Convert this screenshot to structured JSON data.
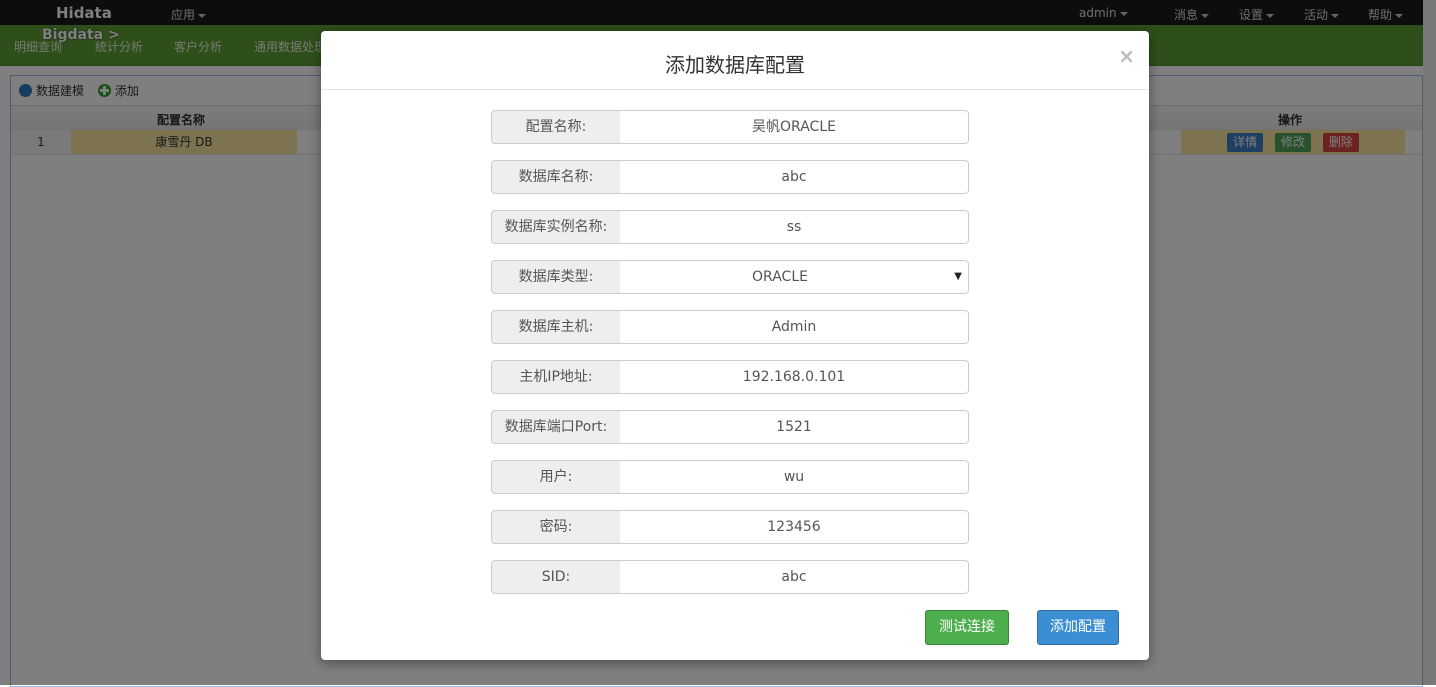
{
  "topbar": {
    "brand": "Hidata",
    "app_menu": "应用",
    "user": "admin",
    "menus": [
      "消息",
      "设置",
      "活动",
      "帮助"
    ]
  },
  "greenbar": {
    "sub_brand": "Bigdata  >",
    "nav": [
      "明细查询",
      "统计分析",
      "客户分析",
      "通用数据处理"
    ]
  },
  "toolbar": {
    "model": "数据建模",
    "add": "添加"
  },
  "grid": {
    "headers": {
      "name": "配置名称",
      "ops": "操作"
    },
    "rows": [
      {
        "index": "1",
        "name": "康雪丹 DB"
      }
    ],
    "actions": {
      "detail": "详情",
      "edit": "修改",
      "delete": "删除"
    }
  },
  "modal": {
    "title": "添加数据库配置",
    "close": "×",
    "fields": [
      {
        "label": "配置名称:",
        "value": "吴帆ORACLE"
      },
      {
        "label": "数据库名称:",
        "value": "abc"
      },
      {
        "label": "数据库实例名称:",
        "value": "ss"
      },
      {
        "label": "数据库类型:",
        "value": "ORACLE"
      },
      {
        "label": "数据库主机:",
        "value": "Admin"
      },
      {
        "label": "主机IP地址:",
        "value": "192.168.0.101"
      },
      {
        "label": "数据库端口Port:",
        "value": "1521"
      },
      {
        "label": "用户:",
        "value": "wu"
      },
      {
        "label": "密码:",
        "value": "123456"
      },
      {
        "label": "SID:",
        "value": "abc"
      }
    ],
    "test_button": "测试连接",
    "add_button": "添加配置"
  },
  "colors": {
    "green_nav": "#5d9f35",
    "primary": "#3b8ed4",
    "success": "#4cae4c",
    "danger": "#d64541",
    "highlight_row": "#fbe6a2"
  }
}
